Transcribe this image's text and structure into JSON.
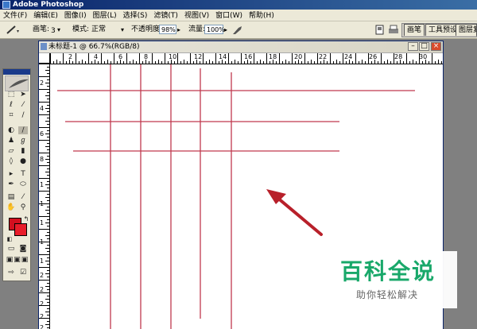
{
  "app": {
    "title": "Adobe Photoshop"
  },
  "menu": [
    "文件(F)",
    "编辑(E)",
    "图像(I)",
    "图层(L)",
    "选择(S)",
    "滤镜(T)",
    "视图(V)",
    "窗口(W)",
    "帮助(H)"
  ],
  "options": {
    "brush_label": "画笔:",
    "brush_size": "3",
    "mode_label": "模式:",
    "mode_value": "正常",
    "opacity_label": "不透明度:",
    "opacity_value": "98%",
    "flow_label": "流量:",
    "flow_value": "100%"
  },
  "palette_tabs": [
    "画笔",
    "工具预设",
    "图层复合"
  ],
  "document": {
    "title": "未标题-1 @ 66.7%(RGB/8)",
    "ruler_h": [
      "2",
      "4",
      "6",
      "8",
      "10",
      "12",
      "14",
      "16",
      "18",
      "20",
      "22",
      "24",
      "26",
      "28",
      "30"
    ],
    "ruler_v": [
      "2",
      "4",
      "6",
      "8",
      "1",
      "1",
      "1",
      "1",
      "1",
      "2",
      "2",
      "2",
      "2",
      "2"
    ]
  },
  "canvas": {
    "line_color": "#c0394e",
    "arrow_color": "#b8202a"
  },
  "colors": {
    "foreground": "#d30f1f",
    "background": "#e81d2a"
  },
  "watermark": {
    "main": "百科全说",
    "sub": "助你轻松解决"
  }
}
